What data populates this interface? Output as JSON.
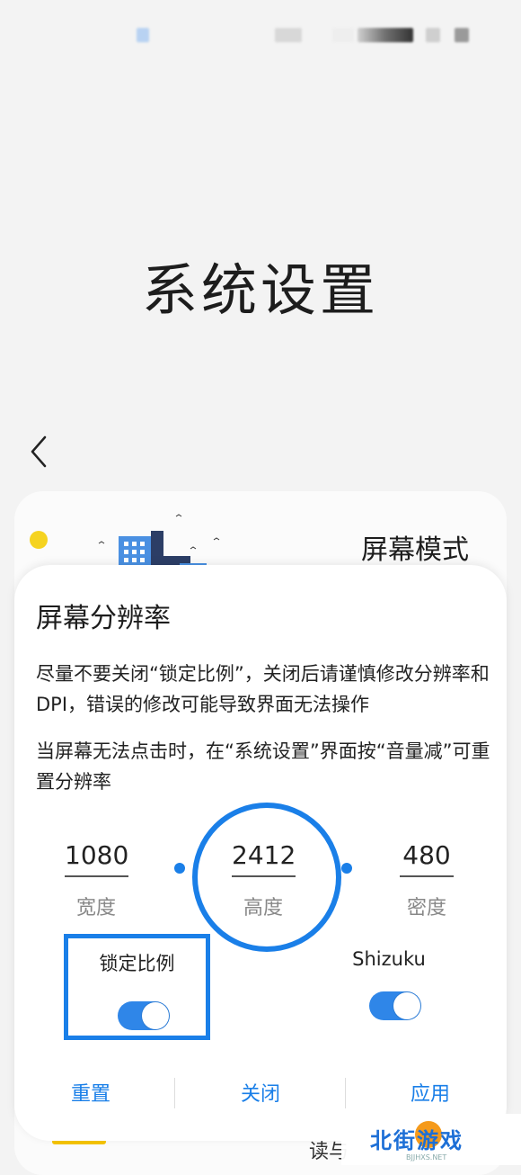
{
  "page": {
    "title": "系统设置"
  },
  "background_card": {
    "mode_title": "屏幕模式",
    "bottom_text": "读与"
  },
  "dialog": {
    "title": "屏幕分辨率",
    "desc1": "尽量不要关闭“锁定比例”，关闭后请谨慎修改分辨率和DPI，错误的修改可能导致界面无法操作",
    "desc2": "当屏幕无法点击时，在“系统设置”界面按“音量减”可重置分辨率",
    "width": {
      "value": "1080",
      "label": "宽度"
    },
    "height": {
      "value": "2412",
      "label": "高度"
    },
    "density": {
      "value": "480",
      "label": "密度"
    },
    "lock_ratio": {
      "label": "锁定比例",
      "on": true
    },
    "shizuku": {
      "label": "Shizuku",
      "on": true
    },
    "actions": {
      "reset": "重置",
      "close": "关闭",
      "apply": "应用"
    }
  },
  "watermark": {
    "text": "北街游戏",
    "sub": "BJJHXS.NET"
  },
  "colors": {
    "accent": "#1a7fe8",
    "background": "#f3f3f3",
    "sun": "#f5d320"
  }
}
